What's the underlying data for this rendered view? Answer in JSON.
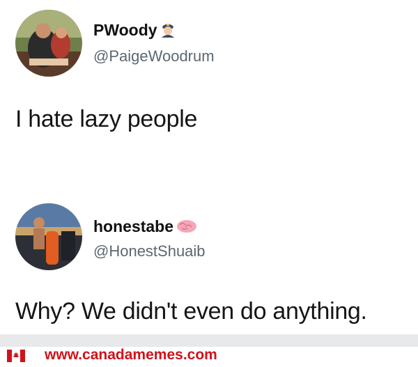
{
  "tweets": [
    {
      "display_name": "PWoody",
      "badge_icon": "police-officer-emoji-icon",
      "handle": "@PaigeWoodrum",
      "text": "I hate lazy people"
    },
    {
      "display_name": "honestabe",
      "badge_icon": "brain-emoji-icon",
      "handle": "@HonestShuaib",
      "text": "Why? We didn't even do anything."
    }
  ],
  "footer": {
    "flag_icon": "canada-flag-icon",
    "site": "www.canadamemes.com",
    "brand_color": "#d0121b"
  }
}
